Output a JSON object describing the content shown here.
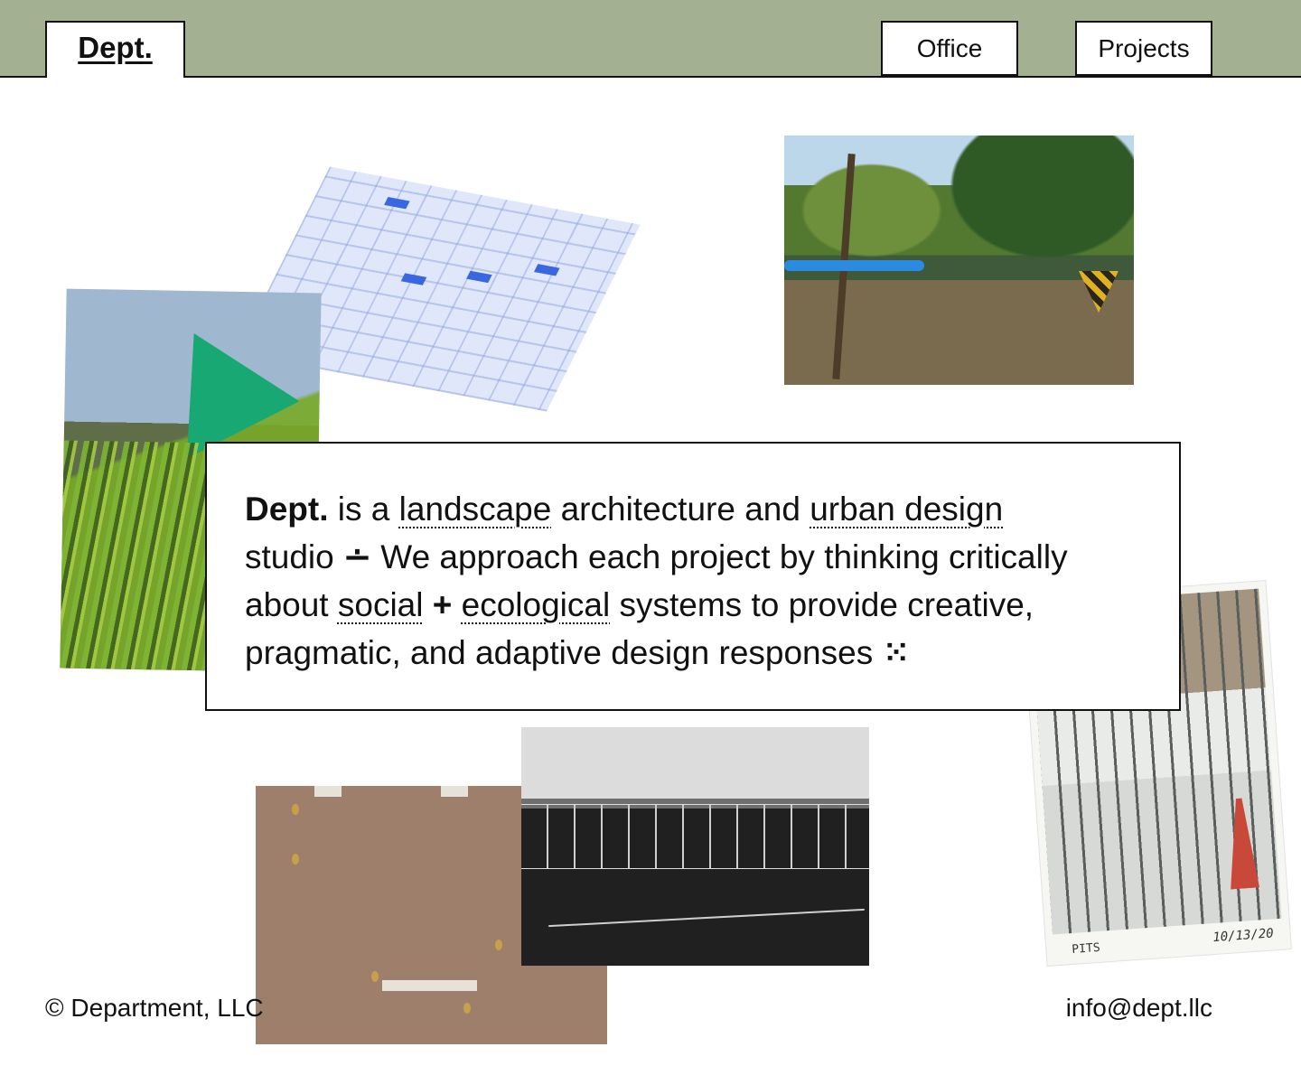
{
  "nav": {
    "home_label": "Dept.",
    "office_label": "Office",
    "projects_label": "Projects"
  },
  "intro": {
    "brand": "Dept.",
    "t1": " is a ",
    "link_landscape": "landscape",
    "t2": " architecture and ",
    "link_urban": "urban design",
    "t3": " studio ",
    "divide_glyph": "∸",
    "t4": " We approach each project by thinking critically about ",
    "link_social": "social",
    "plus": " + ",
    "link_ecological": "ecological",
    "t5": " systems to provide creative, pragmatic, and adaptive design responses ",
    "end_glyph": "⁙"
  },
  "photos": {
    "snow_caption_left": "PITS",
    "snow_caption_right": "10/13/20"
  },
  "footer": {
    "copyright": "© Department, LLC",
    "email": "info@dept.llc"
  },
  "colors": {
    "header_bg": "#a3b192",
    "border": "#111111",
    "background": "#ffffff"
  }
}
